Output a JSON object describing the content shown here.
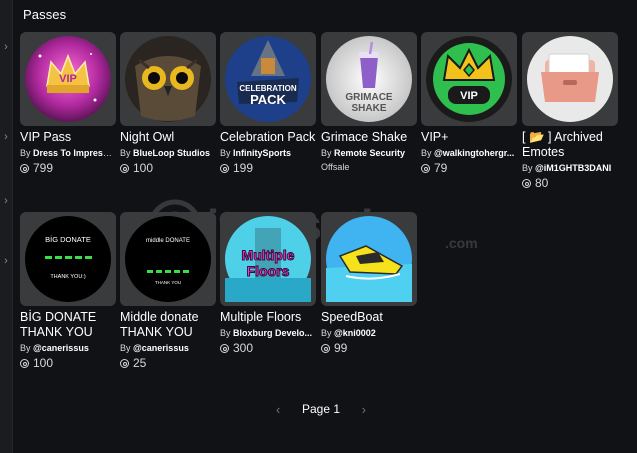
{
  "section": {
    "title": "Passes"
  },
  "watermark": {
    "text": "itemsatis",
    "suffix": ".com"
  },
  "passes": [
    {
      "name": "VIP Pass",
      "creator": "Dress To Impress ...",
      "price": "799"
    },
    {
      "name": "Night Owl",
      "creator": "BlueLoop Studios",
      "price": "100"
    },
    {
      "name": "Celebration Pack",
      "creator": "InfinitySports",
      "price": "199"
    },
    {
      "name": "Grimace Shake",
      "creator": "Remote Security",
      "offsale": "Offsale"
    },
    {
      "name": "VIP+",
      "creator": "@walkingtohergr...",
      "price": "79"
    },
    {
      "name": "[ 📂 ] Archived Emotes",
      "creator": "@iM1GHTB3DANI",
      "price": "80"
    },
    {
      "name": "BİG DONATE THANK YOU",
      "creator": "@canerissus",
      "price": "100"
    },
    {
      "name": "Middle donate THANK YOU",
      "creator": "@canerissus",
      "price": "25"
    },
    {
      "name": "Multiple Floors",
      "creator": "Bloxburg Develo...",
      "price": "300"
    },
    {
      "name": "SpeedBoat",
      "creator": "@kni0002",
      "price": "99"
    }
  ],
  "thumb_text": {
    "vip_pass": "VIP",
    "celebration_1": "CELEBRATION",
    "celebration_2": "PACK",
    "grimace_1": "GRIMACE",
    "grimace_2": "SHAKE",
    "vip_plus": "VIP",
    "big_donate_title": "BİG DONATE",
    "big_donate_thanks": "THANK YOU:)",
    "middle_donate_title": "middle DONATE",
    "middle_donate_thanks": "THANK YOU",
    "multiple_1": "Multiple",
    "multiple_2": "Floors"
  },
  "pager": {
    "label": "Page 1"
  },
  "colors": {
    "background": "#111216",
    "card": "#393b3d",
    "text": "#ffffff",
    "muted": "#d6d7d9"
  }
}
